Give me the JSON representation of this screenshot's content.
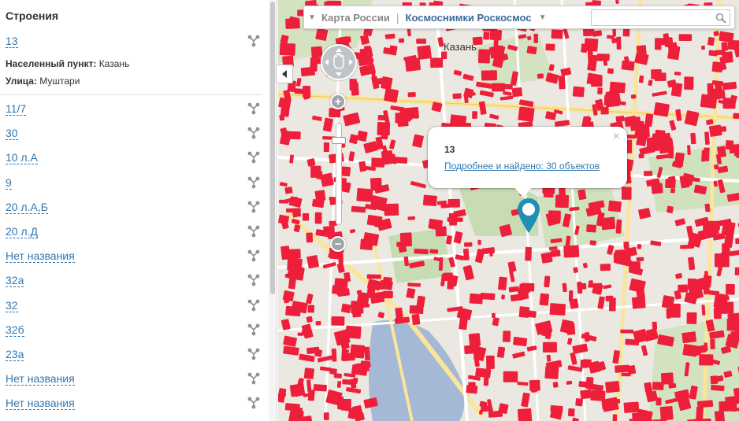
{
  "sidebar": {
    "title": "Строения",
    "selected": {
      "label": "13",
      "settlement_label": "Населенный пункт:",
      "settlement_value": "Казань",
      "street_label": "Улица:",
      "street_value": "Муштари"
    },
    "items": [
      {
        "label": "11/7"
      },
      {
        "label": "30"
      },
      {
        "label": "10 л.А"
      },
      {
        "label": "9"
      },
      {
        "label": "20 л.А,Б"
      },
      {
        "label": "20 л.Д"
      },
      {
        "label": "Нет названия"
      },
      {
        "label": "32а"
      },
      {
        "label": "32"
      },
      {
        "label": "32б"
      },
      {
        "label": "23а"
      },
      {
        "label": "Нет названия"
      },
      {
        "label": "Нет названия"
      }
    ]
  },
  "map": {
    "layers": [
      "Карта России",
      "Космоснимки Роскосмос"
    ],
    "search_placeholder": "",
    "popup": {
      "title": "13",
      "link": "Подробнее и найдено: 30 объектов"
    },
    "colors": {
      "building": "#ee1f3a",
      "water": "#a5b9d6",
      "park": "#c7dcb3",
      "road_major": "#fbe59a",
      "accent": "#3277b0",
      "marker": "#1f8fb3"
    }
  }
}
